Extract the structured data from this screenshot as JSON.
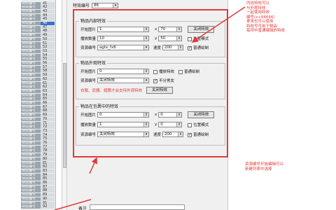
{
  "list": {
    "item_label": "特效编号",
    "numbers": [
      "41",
      "42",
      "43",
      "44",
      "45",
      "46",
      "47",
      "48",
      "49",
      "50",
      "51",
      "52",
      "53",
      "54",
      "55",
      "56",
      "57",
      "58",
      "59",
      "60",
      "61",
      "62",
      "63",
      "64",
      "65",
      "66",
      "67",
      "68",
      "69",
      "70",
      "71",
      "72",
      "73",
      "74",
      "75",
      "76",
      "77",
      "78",
      "79",
      "80",
      "81",
      "82",
      "83",
      "84",
      "85",
      "86",
      "87",
      "88",
      "89",
      "90",
      "91",
      "92"
    ],
    "selected_index": 5
  },
  "header": {
    "effect_id_label": "特效编号",
    "effect_id_value": "86"
  },
  "group_in_hand": {
    "title": "物品内部特效",
    "start_frame_label": "开始图片",
    "start_frame_value": "1",
    "x_label": "x",
    "x_value": "70",
    "close_button": "关闭特效",
    "frame_count_label": "播放数量",
    "frame_count_value": "10",
    "y_label": "y",
    "y_value": "50",
    "position_mode_label": "位置模式",
    "resource_label": "资源编号",
    "resource_value": "agtx_fx6",
    "speed_label": "速度",
    "speed_value": "200",
    "normal_draw_label": "普通绘制"
  },
  "group_on_ground": {
    "title": "物品外观特效",
    "start_frame_label": "开始图片",
    "start_frame_value": "0",
    "follow_label": "播放特效",
    "normal_draw_label": "普通绘制",
    "resource_label": "资源编号",
    "resource_value": "关闭特效",
    "gender_label": "不分男女",
    "warning": "衣服、武器、翅膀才会支持外观特效",
    "close_button": "关闭特效"
  },
  "group_in_bag": {
    "title": "物品在包裹中的特效",
    "start_frame_label": "开始图片",
    "start_frame_value": "0",
    "x_label": "x",
    "x_value": "0",
    "close_button": "关闭特效",
    "frame_count_label": "播放数量",
    "frame_count_value": "1",
    "y_label": "y",
    "y_value": "0",
    "position_mode_label": "位置模式",
    "resource_label": "资源编号",
    "resource_value": "关闭特效",
    "speed_label": "速度",
    "speed_value": "200",
    "normal_draw_label": "普通绘制"
  },
  "annotations": {
    "top_right": [
      "内挂特效可以",
      "与外观特效",
      "一起使用特效",
      "编号(x+66666)",
      "拿来也可以使用",
      "特效号可用于物品",
      "每项中普通编辑的特效"
    ],
    "bottom_right": [
      "资源编号开始编辑可以",
      "新建列表中选择"
    ]
  },
  "footer": {
    "remark_label": "备注"
  },
  "colors": {
    "highlight": "#e03a3a",
    "selection": "#3a6fd0"
  }
}
